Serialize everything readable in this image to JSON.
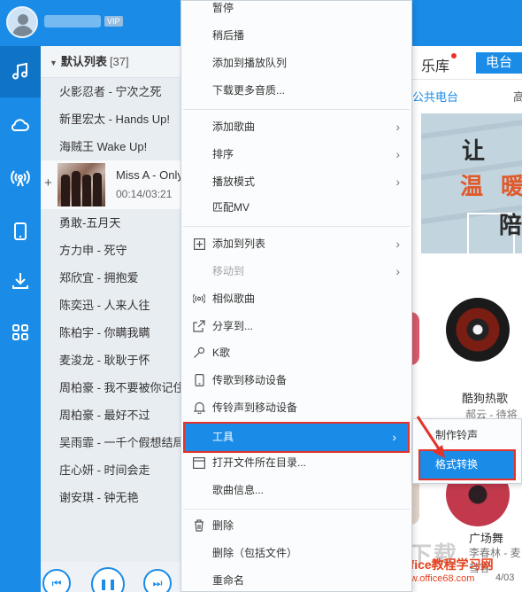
{
  "user": {
    "vip_label": "VIP"
  },
  "sidebar": {
    "icons": [
      "music-note-icon",
      "cloud-icon",
      "broadcast-icon",
      "phone-icon",
      "download-icon",
      "apps-grid-icon"
    ]
  },
  "playlist": {
    "name": "默认列表",
    "count": "[37]",
    "songs_before": [
      "火影忍者 - 宁次之死",
      "新里宏太 - Hands Up!",
      "海贼王 Wake Up!"
    ],
    "now_playing": {
      "title": "Miss A - Only You",
      "time": "00:14/03:21"
    },
    "songs_after": [
      "勇敢-五月天",
      "方力申 - 死守",
      "郑欣宜 - 拥抱爱",
      "陈奕迅 - 人来人往",
      "陈柏宇 - 你瞒我瞒",
      "麦浚龙 - 耿耿于怀",
      "周柏豪 - 我不要被你记住",
      "周柏豪 - 最好不过",
      "吴雨霏 - 一千个假想结局",
      "庄心妍 - 时间会走",
      "谢安琪 - 钟无艳"
    ]
  },
  "context_menu": [
    {
      "label": "暂停",
      "icon": "",
      "arrow": false,
      "disabled": false
    },
    {
      "label": "稍后播",
      "icon": "",
      "arrow": false,
      "disabled": false
    },
    {
      "label": "添加到播放队列",
      "icon": "",
      "arrow": false,
      "disabled": false
    },
    {
      "label": "下载更多音质...",
      "icon": "",
      "arrow": false,
      "disabled": false
    },
    {
      "label": "添加歌曲",
      "icon": "",
      "arrow": true,
      "disabled": false
    },
    {
      "label": "排序",
      "icon": "",
      "arrow": true,
      "disabled": false
    },
    {
      "label": "播放模式",
      "icon": "",
      "arrow": true,
      "disabled": false
    },
    {
      "label": "匹配MV",
      "icon": "",
      "arrow": false,
      "disabled": false
    },
    {
      "label": "添加到列表",
      "icon": "plus-box-icon",
      "arrow": true,
      "disabled": false
    },
    {
      "label": "移动到",
      "icon": "",
      "arrow": true,
      "disabled": true
    },
    {
      "label": "相似歌曲",
      "icon": "similar-icon",
      "arrow": false,
      "disabled": false
    },
    {
      "label": "分享到...",
      "icon": "share-icon",
      "arrow": false,
      "disabled": false
    },
    {
      "label": "K歌",
      "icon": "microphone-icon",
      "arrow": false,
      "disabled": false
    },
    {
      "label": "传歌到移动设备",
      "icon": "phone-icon",
      "arrow": false,
      "disabled": false
    },
    {
      "label": "传铃声到移动设备",
      "icon": "bell-icon",
      "arrow": false,
      "disabled": false
    },
    {
      "label": "工具",
      "icon": "",
      "arrow": true,
      "disabled": false
    },
    {
      "label": "打开文件所在目录...",
      "icon": "folder-icon",
      "arrow": false,
      "disabled": false
    },
    {
      "label": "歌曲信息...",
      "icon": "",
      "arrow": false,
      "disabled": false
    },
    {
      "label": "删除",
      "icon": "trash-icon",
      "arrow": false,
      "disabled": false
    },
    {
      "label": "删除（包括文件）",
      "icon": "",
      "arrow": false,
      "disabled": false
    },
    {
      "label": "重命名",
      "icon": "",
      "arrow": false,
      "disabled": false
    }
  ],
  "submenu": {
    "items": [
      "制作铃声",
      "格式转换"
    ]
  },
  "right": {
    "tab_library": "乐库",
    "tab_radio": "电台",
    "sub_public": "公共电台",
    "sub_high": "高",
    "banner_chars": [
      "让",
      "温",
      "暖",
      "陪"
    ],
    "card1_title": "酷狗热歌",
    "card1_sub": "郝云 - 待将说",
    "card2_title": "广场舞",
    "card2_sub": "李春林 - 麦彗客",
    "player_time": "4/03",
    "watermark_main": "下载",
    "watermark_site": "Office教程学习网",
    "watermark_url": "www.office68.com"
  }
}
